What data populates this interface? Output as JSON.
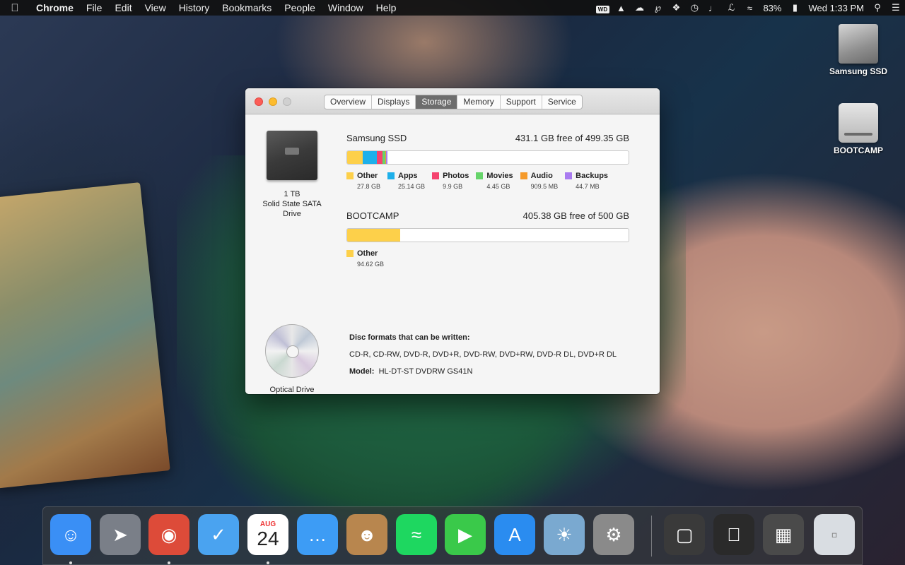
{
  "menubar": {
    "app_name": "Chrome",
    "menus": [
      "File",
      "Edit",
      "View",
      "History",
      "Bookmarks",
      "People",
      "Window",
      "Help"
    ],
    "battery": "83%",
    "clock": "Wed 1:33 PM",
    "wd_label": "WD"
  },
  "desktop": {
    "icons": [
      {
        "label": "Samsung SSD"
      },
      {
        "label": "BOOTCAMP"
      }
    ]
  },
  "window": {
    "tabs": [
      "Overview",
      "Displays",
      "Storage",
      "Memory",
      "Support",
      "Service"
    ],
    "active_tab": "Storage",
    "drive": {
      "caption": "1 TB\nSolid State SATA\nDrive"
    },
    "volumes": [
      {
        "name": "Samsung SSD",
        "free_text": "431.1 GB free of 499.35 GB",
        "total_gb": 499.35,
        "segments": [
          {
            "label": "Other",
            "value": "27.8 GB",
            "gb": 27.8,
            "color": "#fdd04a"
          },
          {
            "label": "Apps",
            "value": "25.14 GB",
            "gb": 25.14,
            "color": "#1eb0ea"
          },
          {
            "label": "Photos",
            "value": "9.9 GB",
            "gb": 9.9,
            "color": "#f5436e"
          },
          {
            "label": "Movies",
            "value": "4.45 GB",
            "gb": 4.45,
            "color": "#66d46a"
          },
          {
            "label": "Audio",
            "value": "909.5 MB",
            "gb": 0.9095,
            "color": "#f59a2a"
          },
          {
            "label": "Backups",
            "value": "44.7 MB",
            "gb": 0.0447,
            "color": "#a97bf0"
          }
        ]
      },
      {
        "name": "BOOTCAMP",
        "free_text": "405.38 GB free of 500 GB",
        "total_gb": 500,
        "segments": [
          {
            "label": "Other",
            "value": "94.62 GB",
            "gb": 94.62,
            "color": "#fdd04a"
          }
        ]
      }
    ],
    "optical": {
      "caption": "Optical Drive",
      "formats_label": "Disc formats that can be written:",
      "formats": "CD-R, CD-RW, DVD-R, DVD+R, DVD-RW, DVD+RW, DVD-R DL, DVD+R DL",
      "model_label": "Model:",
      "model": "HL-DT-ST DVDRW GS41N"
    }
  },
  "dock": {
    "calendar_month": "AUG",
    "calendar_day": "24",
    "apps": [
      {
        "name": "finder",
        "icon": "finder-icon",
        "color": "#3a8ff5",
        "running": true
      },
      {
        "name": "launchpad",
        "icon": "rocket-icon",
        "color": "#7a7f88",
        "running": false
      },
      {
        "name": "chrome",
        "icon": "chrome-icon",
        "color": "#dd4b39",
        "running": true
      },
      {
        "name": "airmail",
        "icon": "checkmark-icon",
        "color": "#4aa3f0",
        "running": false
      },
      {
        "name": "calendar",
        "icon": "calendar-icon",
        "color": "#ffffff",
        "running": true
      },
      {
        "name": "messages",
        "icon": "speech-bubble-icon",
        "color": "#3d9cf5",
        "running": false
      },
      {
        "name": "contacts",
        "icon": "contacts-icon",
        "color": "#b8864e",
        "running": false
      },
      {
        "name": "spotify",
        "icon": "spotify-icon",
        "color": "#1ed760",
        "running": false
      },
      {
        "name": "facetime",
        "icon": "video-camera-icon",
        "color": "#3ac94a",
        "running": false
      },
      {
        "name": "app-store",
        "icon": "app-store-icon",
        "color": "#2a8cf0",
        "running": false
      },
      {
        "name": "iphoto",
        "icon": "photo-icon",
        "color": "#7aa9d0",
        "running": false
      },
      {
        "name": "system-preferences",
        "icon": "gear-icon",
        "color": "#8a8a8a",
        "running": false
      },
      {
        "name": "applications-folder",
        "icon": "folder-icon",
        "color": "#3a3a3a",
        "running": false
      },
      {
        "name": "apple-folder",
        "icon": "apple-folder-icon",
        "color": "#2a2a2a",
        "running": false
      },
      {
        "name": "downloads-stack",
        "icon": "downloads-stack-icon",
        "color": "#4a4a4a",
        "running": false
      },
      {
        "name": "trash",
        "icon": "trash-icon",
        "color": "#d9dde2",
        "running": false
      }
    ]
  }
}
